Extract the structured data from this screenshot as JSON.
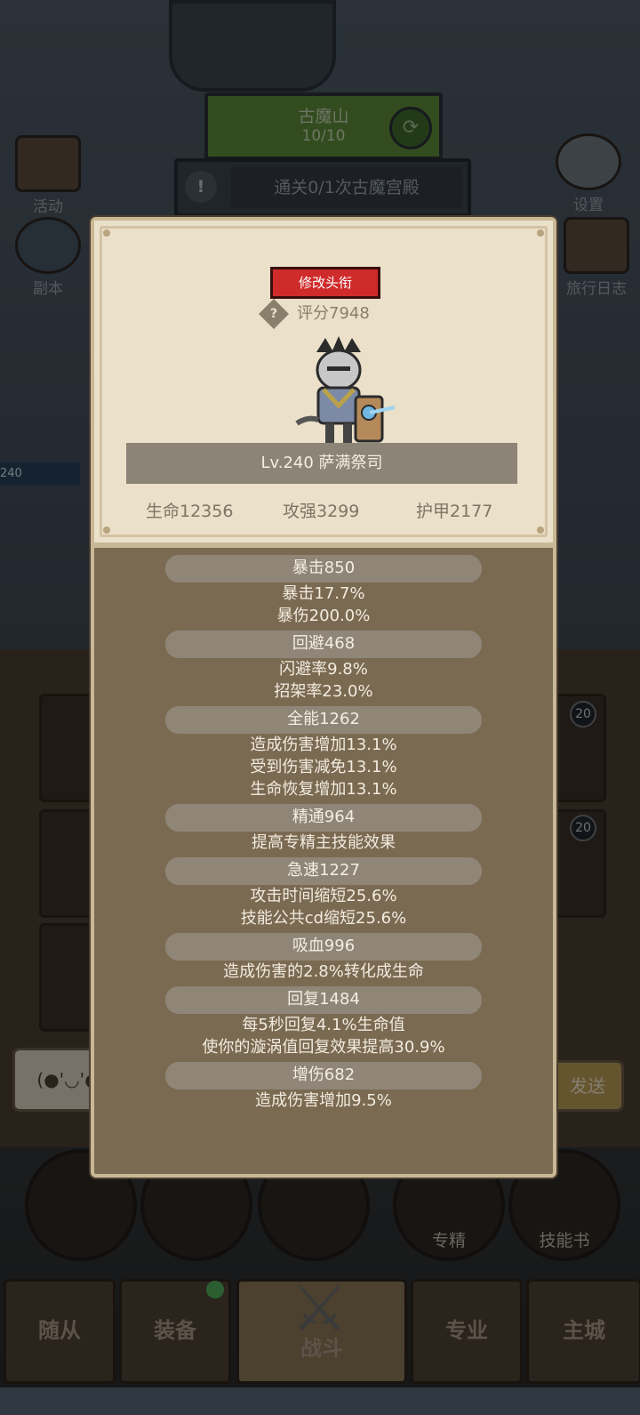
{
  "background": {
    "region": {
      "name": "古魔山",
      "progress": "10/10"
    },
    "quest": {
      "text": "通关0/1次古魔宫殿"
    },
    "side_left": [
      {
        "label": "活动"
      },
      {
        "label": "副本"
      }
    ],
    "side_right": [
      {
        "label": "设置"
      },
      {
        "label": "旅行日志"
      }
    ],
    "player_level": "240",
    "chat_emote": "(●'◡'●",
    "send_label": "发送",
    "circles": [
      {
        "label": ""
      },
      {
        "label": ""
      },
      {
        "label": ""
      },
      {
        "label": "专精"
      },
      {
        "label": "技能书"
      }
    ],
    "tabs": [
      {
        "label": "随从"
      },
      {
        "label": "装备"
      },
      {
        "label": "战斗"
      },
      {
        "label": "专业"
      },
      {
        "label": "主城"
      }
    ],
    "badges": [
      "20",
      "20"
    ]
  },
  "modal": {
    "edit_title_label": "修改头衔",
    "score_label": "评分7948",
    "hero_level_name": "Lv.240 萨满祭司",
    "main_stats": {
      "hp": "生命12356",
      "atk": "攻强3299",
      "armor": "护甲2177"
    },
    "sections": [
      {
        "header": "暴击850",
        "lines": [
          "暴击17.7%",
          "暴伤200.0%"
        ]
      },
      {
        "header": "回避468",
        "lines": [
          "闪避率9.8%",
          "招架率23.0%"
        ]
      },
      {
        "header": "全能1262",
        "lines": [
          "造成伤害增加13.1%",
          "受到伤害减免13.1%",
          "生命恢复增加13.1%"
        ]
      },
      {
        "header": "精通964",
        "lines": [
          "提高专精主技能效果"
        ]
      },
      {
        "header": "急速1227",
        "lines": [
          "攻击时间缩短25.6%",
          "技能公共cd缩短25.6%"
        ]
      },
      {
        "header": "吸血996",
        "lines": [
          "造成伤害的2.8%转化成生命"
        ]
      },
      {
        "header": "回复1484",
        "lines": [
          "每5秒回复4.1%生命值",
          "使你的漩涡值回复效果提高30.9%"
        ]
      },
      {
        "header": "增伤682",
        "lines": [
          "造成伤害增加9.5%"
        ]
      }
    ]
  }
}
